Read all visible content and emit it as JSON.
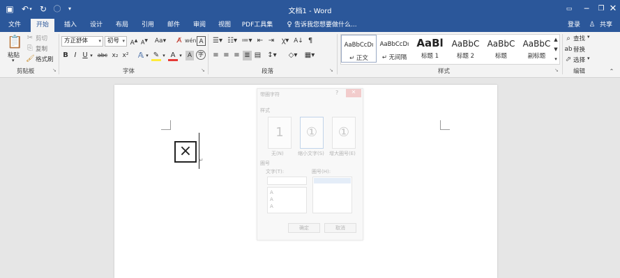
{
  "window": {
    "title": "文档1 - Word",
    "min_icon": "minimize-icon",
    "max_icon": "restore-icon",
    "close_icon": "close-icon"
  },
  "quick_access": [
    "save-icon",
    "undo-icon",
    "redo-icon",
    "touch-icon",
    "customize-icon"
  ],
  "tabs": [
    {
      "label": "文件",
      "active": false
    },
    {
      "label": "开始",
      "active": true
    },
    {
      "label": "插入",
      "active": false
    },
    {
      "label": "设计",
      "active": false
    },
    {
      "label": "布局",
      "active": false
    },
    {
      "label": "引用",
      "active": false
    },
    {
      "label": "邮件",
      "active": false
    },
    {
      "label": "审阅",
      "active": false
    },
    {
      "label": "视图",
      "active": false
    },
    {
      "label": "PDF工具集",
      "active": false
    }
  ],
  "tell_me": "告诉我您想要做什么...",
  "account": {
    "login": "登录",
    "share": "共享"
  },
  "clipboard": {
    "label": "剪贴板",
    "paste": "粘贴",
    "cut": "剪切",
    "copy": "复制",
    "format_painter": "格式刷"
  },
  "font": {
    "label": "字体",
    "family": "方正舒体",
    "size": "初号",
    "bold": "B",
    "italic": "I",
    "underline": "U",
    "strike": "abc",
    "sub": "x₂",
    "sup": "x²"
  },
  "paragraph": {
    "label": "段落"
  },
  "styles": {
    "label": "样式",
    "items": [
      {
        "sample": "AaBbCcDı",
        "name": "↵ 正文",
        "selected": true
      },
      {
        "sample": "AaBbCcDı",
        "name": "↵ 无间隔",
        "selected": false
      },
      {
        "sample": "AaBl",
        "name": "标题 1",
        "selected": false
      },
      {
        "sample": "AaBbC",
        "name": "标题 2",
        "selected": false
      },
      {
        "sample": "AaBbC",
        "name": "标题",
        "selected": false
      },
      {
        "sample": "AaBbC",
        "name": "副标题",
        "selected": false
      }
    ]
  },
  "editing": {
    "label": "编辑",
    "find": "查找",
    "replace": "替换",
    "select": "选择"
  },
  "document": {
    "symbol": "×",
    "para_mark": "↵"
  },
  "dialog": {
    "title": "带圈字符",
    "style_label": "样式",
    "choices": [
      {
        "glyph": "1",
        "label": "无(N)"
      },
      {
        "glyph": "①",
        "label": "缩小文字(S)"
      },
      {
        "glyph": "①",
        "label": "增大圈号(E)"
      }
    ],
    "circle_label": "圈号",
    "text_label": "文字(T):",
    "enclosure_label": "圈号(H):",
    "text_items": [
      "A",
      "A",
      "A"
    ],
    "ok": "确定",
    "cancel": "取消"
  }
}
